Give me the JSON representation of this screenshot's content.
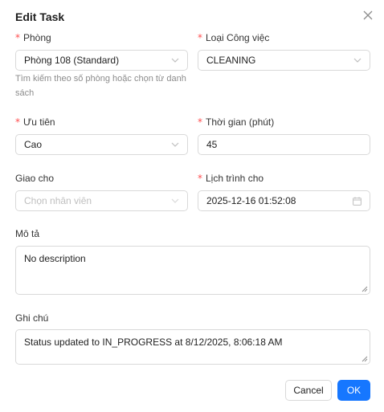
{
  "modal": {
    "title": "Edit Task",
    "required_mark": "*"
  },
  "fields": {
    "room": {
      "label": "Phòng",
      "value": "Phòng 108 (Standard)",
      "hint": "Tìm kiếm theo số phòng hoặc chọn từ danh sách"
    },
    "task_type": {
      "label": "Loại Công việc",
      "value": "CLEANING"
    },
    "priority": {
      "label": "Ưu tiên",
      "value": "Cao"
    },
    "duration": {
      "label": "Thời gian (phút)",
      "value": "45"
    },
    "assignee": {
      "label": "Giao cho",
      "placeholder": "Chọn nhân viên"
    },
    "schedule": {
      "label": "Lịch trình cho",
      "value": "2025-12-16 01:52:08"
    },
    "description": {
      "label": "Mô tả",
      "value": "No description"
    },
    "notes": {
      "label": "Ghi chú",
      "value": "Status updated to IN_PROGRESS at 8/12/2025, 8:06:18 AM"
    }
  },
  "footer": {
    "cancel_label": "Cancel",
    "ok_label": "OK"
  },
  "icons": {
    "close": "close-icon",
    "select_arrow": "chevron-down-icon",
    "calendar": "calendar-icon"
  },
  "colors": {
    "primary": "#1677ff",
    "required": "#ff4d4f",
    "border": "#d9d9d9",
    "hint": "#8c8c8c"
  }
}
